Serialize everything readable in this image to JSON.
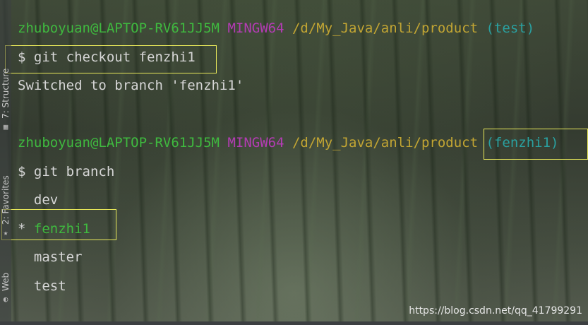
{
  "terminal": {
    "prompt1": {
      "user": "zhuboyuan@LAPTOP-RV61JJ5M",
      "system": "MINGW64",
      "path": "/d/My_Java/anli/product",
      "branch": "(test)"
    },
    "cmd1": "$ git checkout fenzhi1",
    "out1": "Switched to branch 'fenzhi1'",
    "prompt2": {
      "user": "zhuboyuan@LAPTOP-RV61JJ5M",
      "system": "MINGW64",
      "path": "/d/My_Java/anli/product",
      "branch": "(fenzhi1)"
    },
    "cmd2": "$ git branch",
    "branches": {
      "b1": "  dev",
      "current_marker": "* ",
      "current": "fenzhi1",
      "b3": "  master",
      "b4": "  test"
    }
  },
  "sidebar": {
    "structure_label": "7: Structure",
    "favorites_label": "2: Favorites",
    "web_label": "Web"
  },
  "watermark": "https://blog.csdn.net/qq_41799291",
  "colors": {
    "user": "#3fb93f",
    "system": "#b33cb3",
    "path": "#c2a533",
    "branch": "#2aa0a0",
    "highlight_box": "#e8e85a"
  }
}
